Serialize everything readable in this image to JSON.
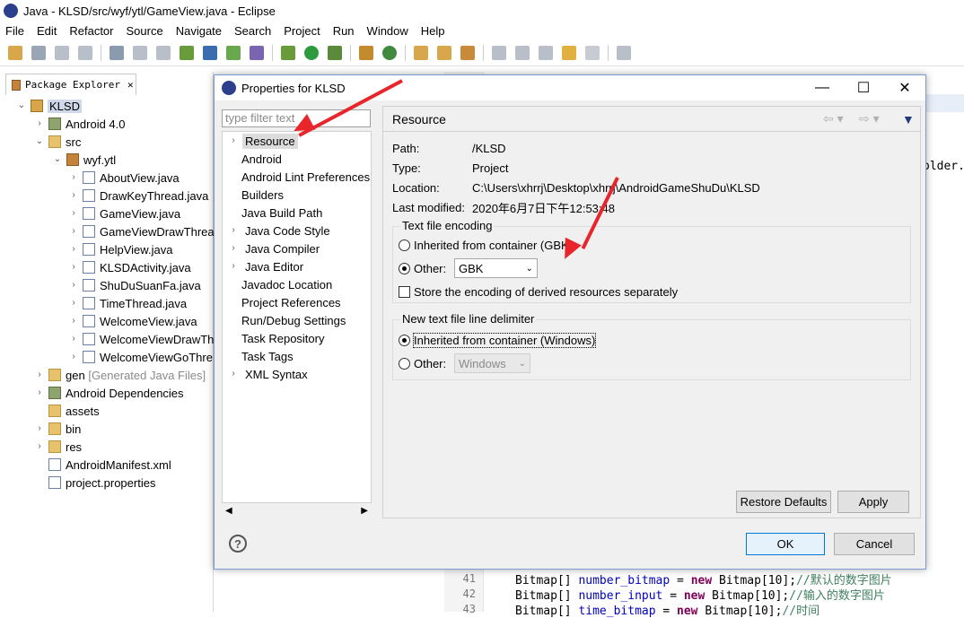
{
  "window": {
    "title": "Java - KLSD/src/wyf/ytl/GameView.java - Eclipse"
  },
  "menu": [
    "File",
    "Edit",
    "Refactor",
    "Source",
    "Navigate",
    "Search",
    "Project",
    "Run",
    "Window",
    "Help"
  ],
  "package_explorer": {
    "tab_label": "Package Explorer",
    "items": [
      {
        "label": "KLSD",
        "extra": ""
      },
      {
        "label": "Android 4.0",
        "extra": ""
      },
      {
        "label": "src",
        "extra": ""
      },
      {
        "label": "wyf.ytl",
        "extra": ""
      },
      {
        "label": "AboutView.java",
        "extra": ""
      },
      {
        "label": "DrawKeyThread.java",
        "extra": ""
      },
      {
        "label": "GameView.java",
        "extra": ""
      },
      {
        "label": "GameViewDrawThread",
        "extra": ""
      },
      {
        "label": "HelpView.java",
        "extra": ""
      },
      {
        "label": "KLSDActivity.java",
        "extra": ""
      },
      {
        "label": "ShuDuSuanFa.java",
        "extra": ""
      },
      {
        "label": "TimeThread.java",
        "extra": ""
      },
      {
        "label": "WelcomeView.java",
        "extra": ""
      },
      {
        "label": "WelcomeViewDrawTh",
        "extra": ""
      },
      {
        "label": "WelcomeViewGoThre",
        "extra": ""
      },
      {
        "label": "gen",
        "extra": "[Generated Java Files]"
      },
      {
        "label": "Android Dependencies",
        "extra": ""
      },
      {
        "label": "assets",
        "extra": ""
      },
      {
        "label": "bin",
        "extra": ""
      },
      {
        "label": "res",
        "extra": ""
      },
      {
        "label": "AndroidManifest.xml",
        "extra": ""
      },
      {
        "label": "project.properties",
        "extra": ""
      }
    ]
  },
  "editor": {
    "snippet": "older.",
    "lines": [
      {
        "num": "41",
        "type": "Bitmap[] ",
        "field": "number_bitmap",
        "rest": " = ",
        "kw": "new",
        "tail": " Bitmap[10];",
        "comment": "//默认的数字图片"
      },
      {
        "num": "42",
        "type": "Bitmap[] ",
        "field": "number_input",
        "rest": " = ",
        "kw": "new",
        "tail": " Bitmap[10];",
        "comment": "//输入的数字图片"
      },
      {
        "num": "43",
        "type": "Bitmap[] ",
        "field": "time_bitmap",
        "rest": " = ",
        "kw": "new",
        "tail": " Bitmap[10];",
        "comment": "//时间"
      }
    ]
  },
  "dialog": {
    "title": "Properties for KLSD",
    "filter_placeholder": "type filter text",
    "nav": [
      "Resource",
      "Android",
      "Android Lint Preferences",
      "Builders",
      "Java Build Path",
      "Java Code Style",
      "Java Compiler",
      "Java Editor",
      "Javadoc Location",
      "Project References",
      "Run/Debug Settings",
      "Task Repository",
      "Task Tags",
      "XML Syntax"
    ],
    "section_title": "Resource",
    "path_label": "Path:",
    "path_value": "/KLSD",
    "type_label": "Type:",
    "type_value": "Project",
    "location_label": "Location:",
    "location_value": "C:\\Users\\xhrrj\\Desktop\\xhrrj\\AndroidGameShuDu\\KLSD",
    "modified_label": "Last modified:",
    "modified_value": "2020年6月7日下午12:53:48",
    "encoding_group": "Text file encoding",
    "enc_inherited": "Inherited from container (GBK)",
    "enc_other": "Other:",
    "enc_value": "GBK",
    "enc_store": "Store the encoding of derived resources separately",
    "delim_group": "New text file line delimiter",
    "delim_inherited": "Inherited from container (Windows)",
    "delim_other": "Other:",
    "delim_value": "Windows",
    "restore_defaults": "Restore Defaults",
    "apply": "Apply",
    "ok": "OK",
    "cancel": "Cancel",
    "help": "?"
  },
  "colors": {
    "arrow": "#e8252a",
    "accent": "#0078d7"
  }
}
